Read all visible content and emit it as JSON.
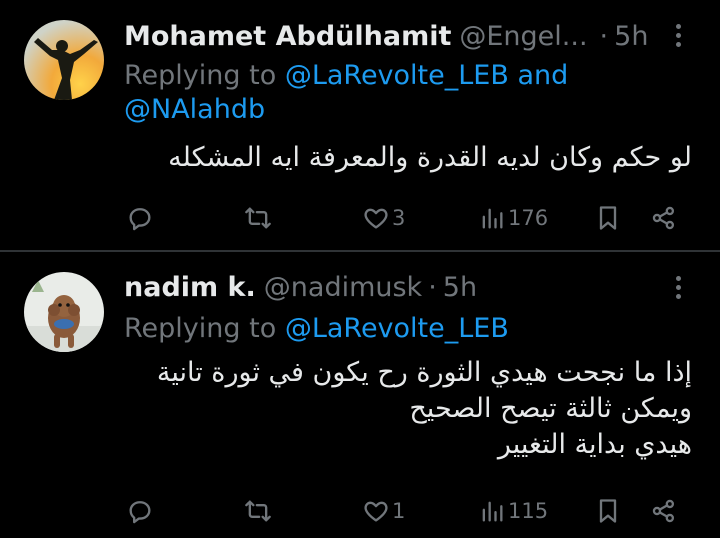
{
  "tweets": [
    {
      "author_name": "Mohamet Abdülhamit",
      "handle": "@Engel...",
      "separator": "·",
      "time": "5h",
      "replying_prefix": "Replying to ",
      "mention_1": "@LaRevolte_LEB",
      "mention_joiner": " and ",
      "mention_2": "@NAlahdb",
      "text_lines": [
        "لو حكم وكان لديه القدرة والمعرفة ايه المشكله"
      ],
      "likes": "3",
      "views": "176",
      "replies": "",
      "retweets": ""
    },
    {
      "author_name": "nadim k.",
      "handle": "@nadimusk",
      "separator": "·",
      "time": "5h",
      "replying_prefix": "Replying to ",
      "mention_1": "@LaRevolte_LEB",
      "text_lines": [
        "إذا ما نجحت هيدي الثورة رح يكون في ثورة تانية",
        "ويمكن ثالثة تيصح الصحيح",
        "هيدي بداية التغيير"
      ],
      "likes": "1",
      "views": "115",
      "replies": "",
      "retweets": ""
    }
  ],
  "colors": {
    "background": "#000000",
    "text": "#e7e9ea",
    "muted": "#71767b",
    "mention": "#1d9bf0",
    "divider": "#2f3336"
  },
  "icons": [
    "reply-icon",
    "retweet-icon",
    "like-icon",
    "views-icon",
    "bookmark-icon",
    "share-icon",
    "more-icon"
  ]
}
